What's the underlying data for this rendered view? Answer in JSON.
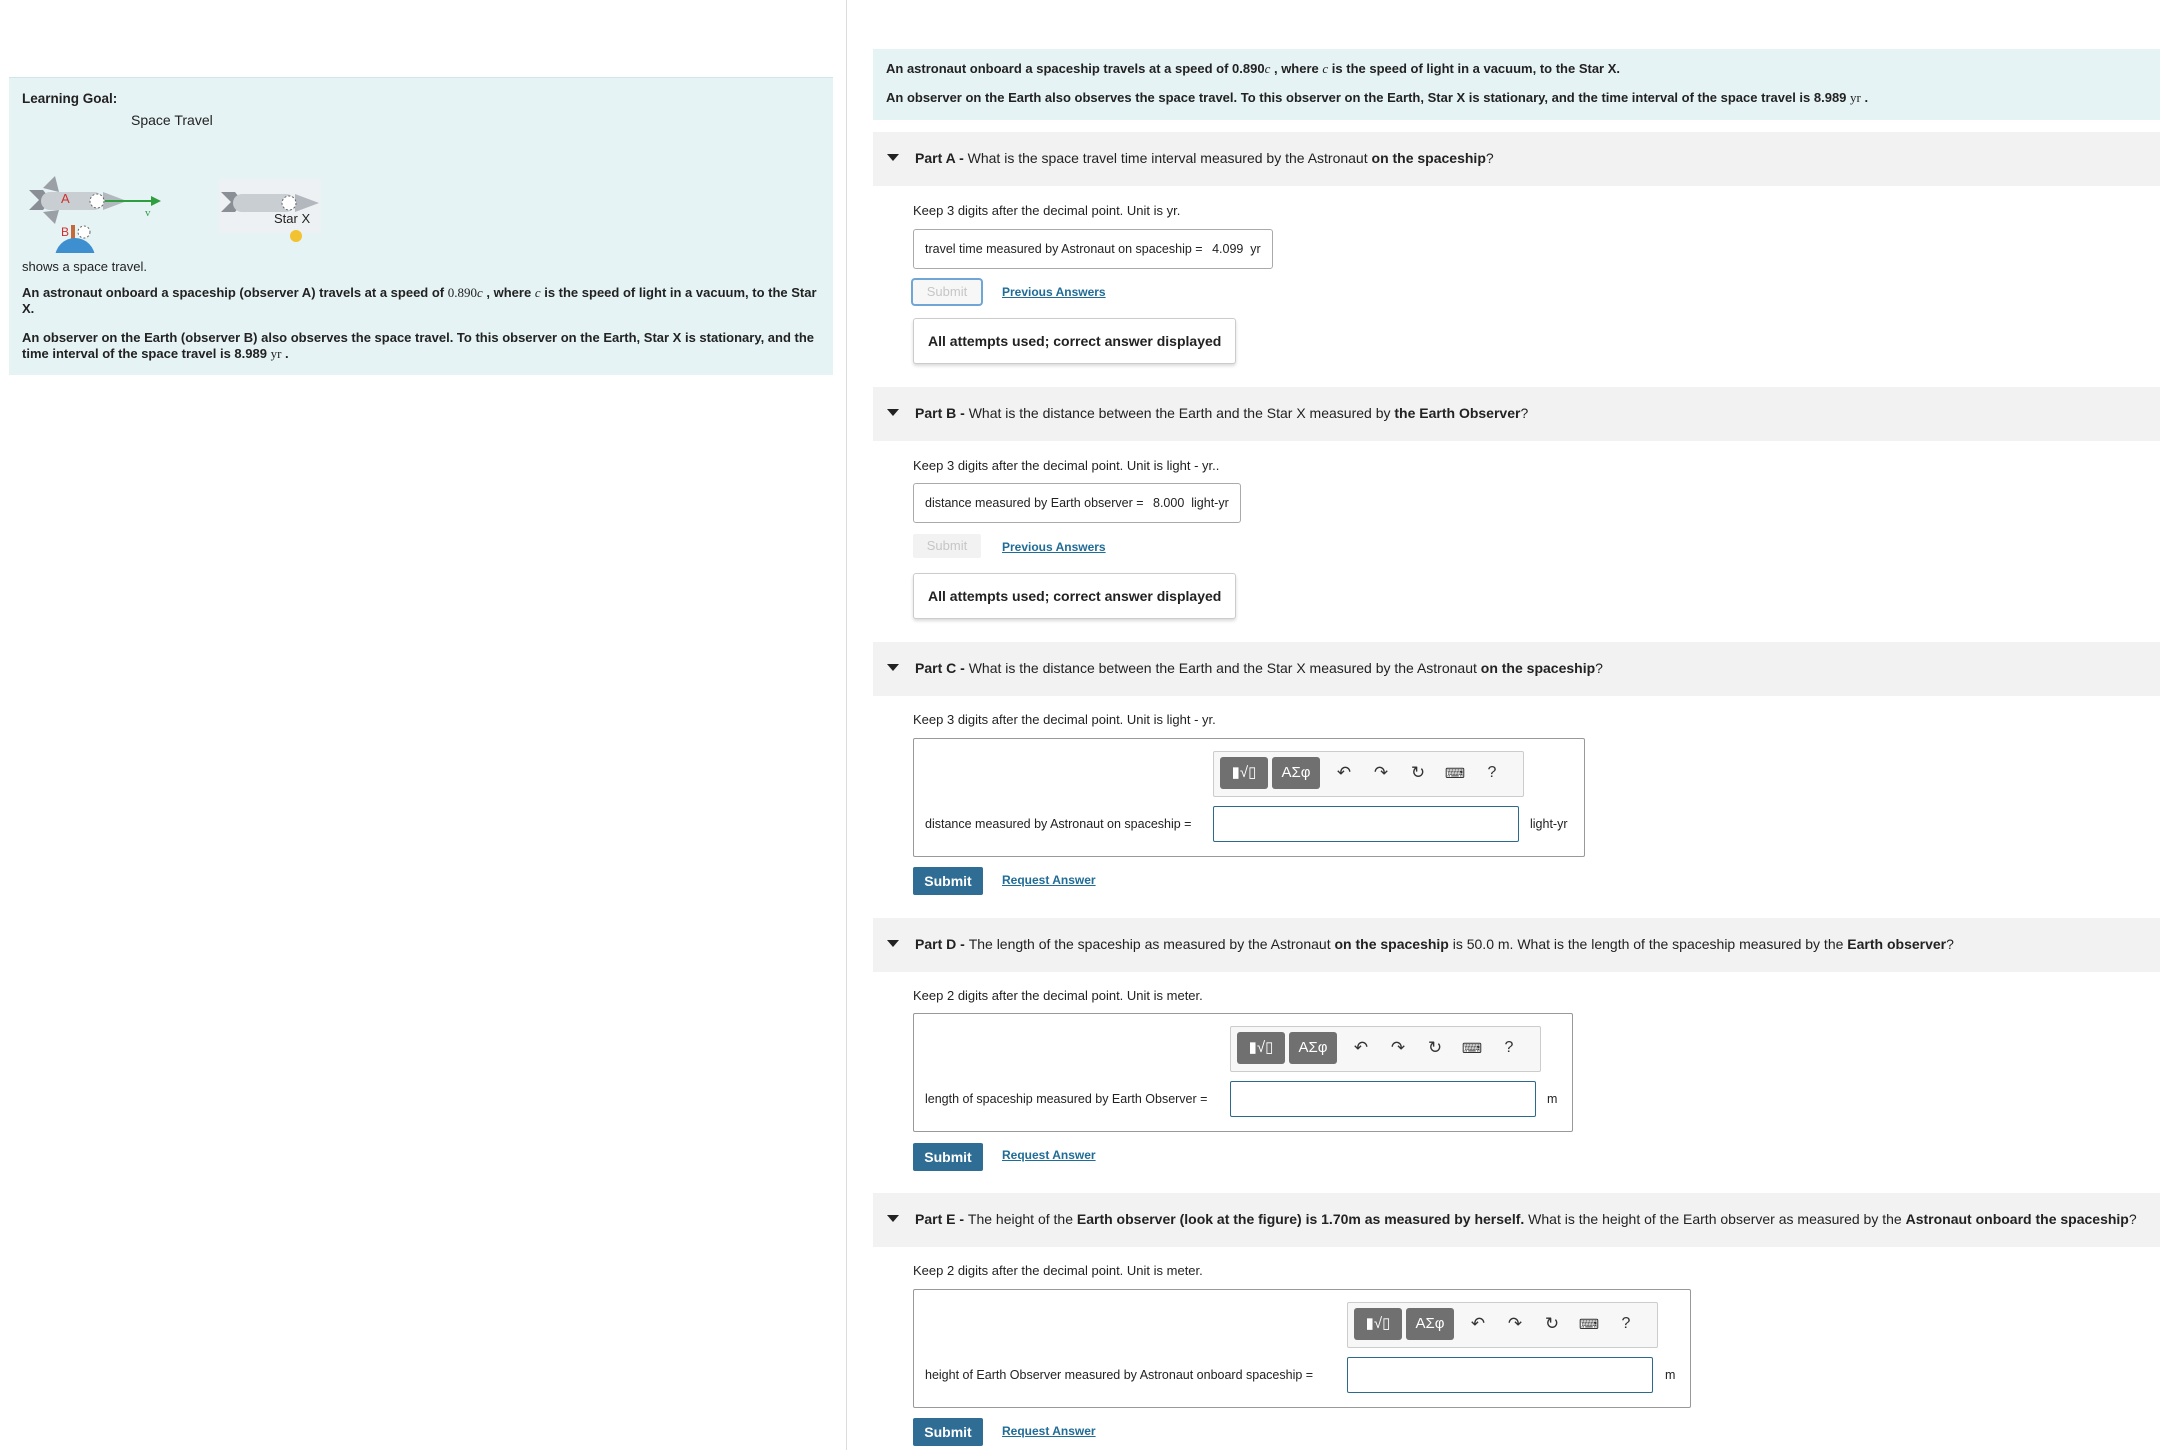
{
  "learning_goal": {
    "title": "Learning Goal:",
    "figure": {
      "caption": "Space Travel",
      "label_a": "A",
      "label_b": "B",
      "label_v": "v",
      "star_label": "Star X"
    },
    "shows": "shows a space travel.",
    "p1_pre": "An astronaut onboard a spaceship (observer A) travels at a speed of ",
    "p1_speed": "0.890",
    "p1_c": "c",
    "p1_mid": " , where ",
    "p1_c2": "c",
    "p1_post": " is the speed of light in a vacuum, to the Star X.",
    "p2_pre": "An observer on the Earth (observer B) also observes the space travel. To this observer on the Earth, Star X is stationary, and the time interval of the space travel is 8.989 ",
    "p2_unit": "yr",
    "p2_post": " ."
  },
  "intro": {
    "line1_pre": "An astronaut onboard a spaceship travels at a speed of 0.890",
    "line1_c": "c",
    "line1_mid": " , where ",
    "line1_c2": "c",
    "line1_post": " is the speed of light in a vacuum, to the Star X.",
    "line2_pre": "An observer on the Earth also observes the space travel. To this observer on the Earth, Star X is stationary, and the time interval of the space travel is 8.989 ",
    "line2_unit": "yr",
    "line2_post": " ."
  },
  "parts": {
    "a": {
      "prefix": "Part A - ",
      "question_pre": "What is the space travel time interval measured by the Astronaut ",
      "question_bold": "on the spaceship",
      "question_post": "?",
      "hint": "Keep 3 digits after the decimal point. Unit is yr.",
      "answer_label": "travel time measured by Astronaut on spaceship = ",
      "answer_value": "4.099",
      "answer_unit": "yr",
      "submit": "Submit",
      "previous": "Previous Answers",
      "status": "All attempts used; correct answer displayed"
    },
    "b": {
      "prefix": "Part B - ",
      "question_pre": "What is the distance between the Earth and the Star X measured by ",
      "question_bold": "the Earth Observer",
      "question_post": "?",
      "hint": "Keep 3 digits after the decimal point. Unit is light - yr..",
      "answer_label": "distance measured by Earth observer = ",
      "answer_value": "8.000",
      "answer_unit": "light-yr",
      "submit": "Submit",
      "previous": "Previous Answers",
      "status": "All attempts used; correct answer displayed"
    },
    "c": {
      "prefix": "Part C - ",
      "question_pre": "What is the distance between the Earth and the Star X measured by the Astronaut ",
      "question_bold": "on the spaceship",
      "question_post": "?",
      "hint": "Keep 3 digits after the decimal point. Unit is light - yr.",
      "input_label": "distance measured by Astronaut on spaceship =",
      "input_value": "",
      "unit": "light-yr",
      "submit": "Submit",
      "request": "Request Answer"
    },
    "d": {
      "prefix": "Part D - ",
      "question_pre": "The length of the spaceship as measured by the Astronaut ",
      "question_bold": "on the spaceship",
      "question_mid": " is 50.0 m. What is the length of the spaceship measured by the ",
      "question_bold2": "Earth observer",
      "question_post": "?",
      "hint": "Keep 2 digits after the decimal point. Unit is meter.",
      "input_label": "length of spaceship measured by Earth Observer =",
      "input_value": "",
      "unit": "m",
      "submit": "Submit",
      "request": "Request Answer"
    },
    "e": {
      "prefix": "Part E - ",
      "question_pre": "The height of the ",
      "question_bold": "Earth observer (look at the figure) is 1.70m as measured by herself.",
      "question_mid": "  What is the height of the Earth observer as measured by the ",
      "question_bold2": "Astronaut onboard the spaceship",
      "question_post": "?",
      "hint": "Keep 2 digits after the decimal point. Unit is meter.",
      "input_label": "height of  Earth Observer  measured by Astronaut onboard spaceship =",
      "input_value": "",
      "unit": "m",
      "submit": "Submit",
      "request": "Request Answer"
    }
  },
  "toolbar": {
    "templates_label": "√",
    "greek_label": "ΑΣφ",
    "undo_icon": "undo-icon",
    "redo_icon": "redo-icon",
    "reset_icon": "reset-icon",
    "keyboard_icon": "keyboard-icon",
    "help_label": "?"
  },
  "colors": {
    "panel_bg": "#e6f3f5",
    "part_header_bg": "#f2f2f2",
    "submit_bg": "#2f6d94",
    "link": "#1f6c96",
    "input_border": "#2b6a8c"
  }
}
